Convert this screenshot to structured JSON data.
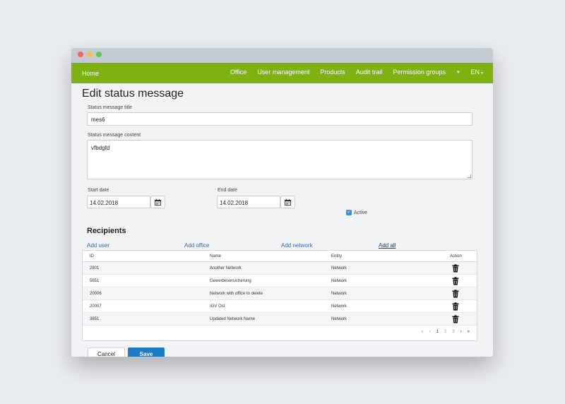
{
  "navbar": {
    "home": "Home",
    "items": [
      "Office",
      "User management",
      "Products",
      "Audit trail",
      "Permission groups"
    ],
    "more_caret": "▾",
    "lang": "EN",
    "lang_caret": "▾"
  },
  "page": {
    "title": "Edit status message"
  },
  "form": {
    "title_label": "Status message title",
    "title_value": "mes6",
    "content_label": "Status message content",
    "content_value": "vfbdgfd",
    "start_label": "Start date",
    "start_value": "14.02.2018",
    "end_label": "End date",
    "end_value": "14.02.2018",
    "active_label": "Active",
    "active_checked": true
  },
  "recipients": {
    "title": "Recipients",
    "links": [
      "Add user",
      "Add office",
      "Add network",
      "Add all"
    ],
    "columns": [
      "ID",
      "Name",
      "Entity",
      "Action"
    ],
    "rows": [
      {
        "id": "2801",
        "name": "Another Network",
        "entity": "Network"
      },
      {
        "id": "5651",
        "name": "Gewerbeversicherung",
        "entity": "Network"
      },
      {
        "id": "20006",
        "name": "Network with office to delete",
        "entity": "Network"
      },
      {
        "id": "20007",
        "name": "IGV Ost",
        "entity": "Network"
      },
      {
        "id": "3851",
        "name": "Updated Network Name",
        "entity": "Network"
      }
    ],
    "pager": [
      "«",
      "‹",
      "1",
      "2",
      "3",
      "›",
      "»"
    ]
  },
  "buttons": {
    "cancel": "Cancel",
    "save": "Save"
  },
  "colors": {
    "navbar": "#7cb313",
    "primary": "#1f7bc4",
    "link": "#2a6dbd"
  },
  "icons": {
    "calendar": "calendar-icon",
    "trash": "trash-icon",
    "check": "check-icon"
  }
}
